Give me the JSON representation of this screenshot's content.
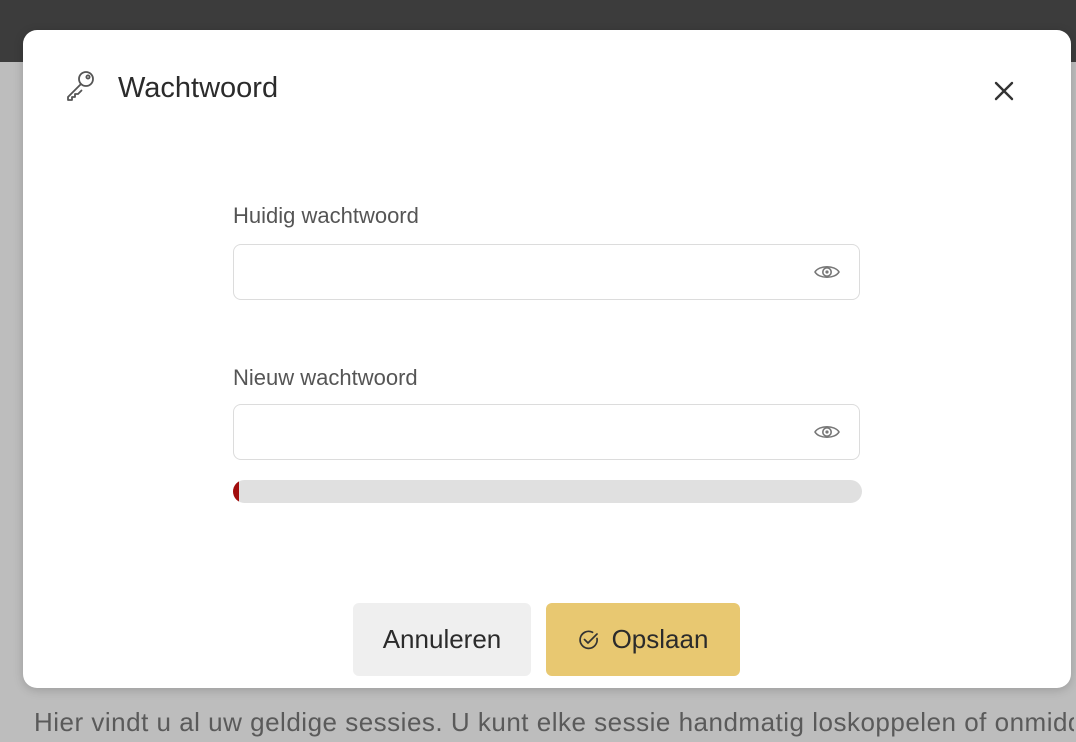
{
  "dialog": {
    "title": "Wachtwoord",
    "icon": "key-icon",
    "close_icon": "close-icon"
  },
  "form": {
    "current_password": {
      "label": "Huidig wachtwoord",
      "value": "",
      "placeholder": "",
      "toggle_icon": "eye-icon"
    },
    "new_password": {
      "label": "Nieuw wachtwoord",
      "value": "",
      "placeholder": "",
      "toggle_icon": "eye-icon"
    },
    "strength": {
      "fraction": 0.01,
      "fill_color": "#a10d0d",
      "track_color": "#e0e0e0"
    }
  },
  "actions": {
    "cancel_label": "Annuleren",
    "save_label": "Opslaan",
    "save_icon": "check-circle-icon",
    "save_color": "#e8c871",
    "cancel_color": "#efefef"
  },
  "backdrop": {
    "text": "Hier vindt u al uw geldige sessies. U kunt elke sessie handmatig loskoppelen of onmiddellijk"
  }
}
